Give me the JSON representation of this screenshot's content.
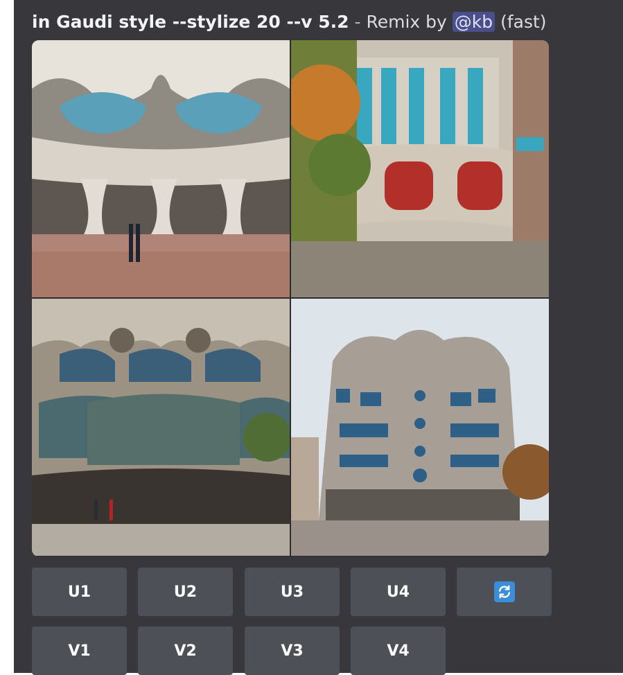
{
  "header": {
    "prompt": "in Gaudi style --stylize 20 --v 5.2",
    "separator": "-",
    "remix_text": "Remix by",
    "mention": "@kb",
    "speed": "(fast)"
  },
  "upscale_buttons": [
    "U1",
    "U2",
    "U3",
    "U4"
  ],
  "variation_buttons": [
    "V1",
    "V2",
    "V3",
    "V4"
  ],
  "reroll_icon": "refresh-icon",
  "colors": {
    "panel_bg": "#37373c",
    "button_bg": "#4e5058",
    "reroll_accent": "#3b8fd9",
    "mention_bg": "#4a4f8c"
  }
}
